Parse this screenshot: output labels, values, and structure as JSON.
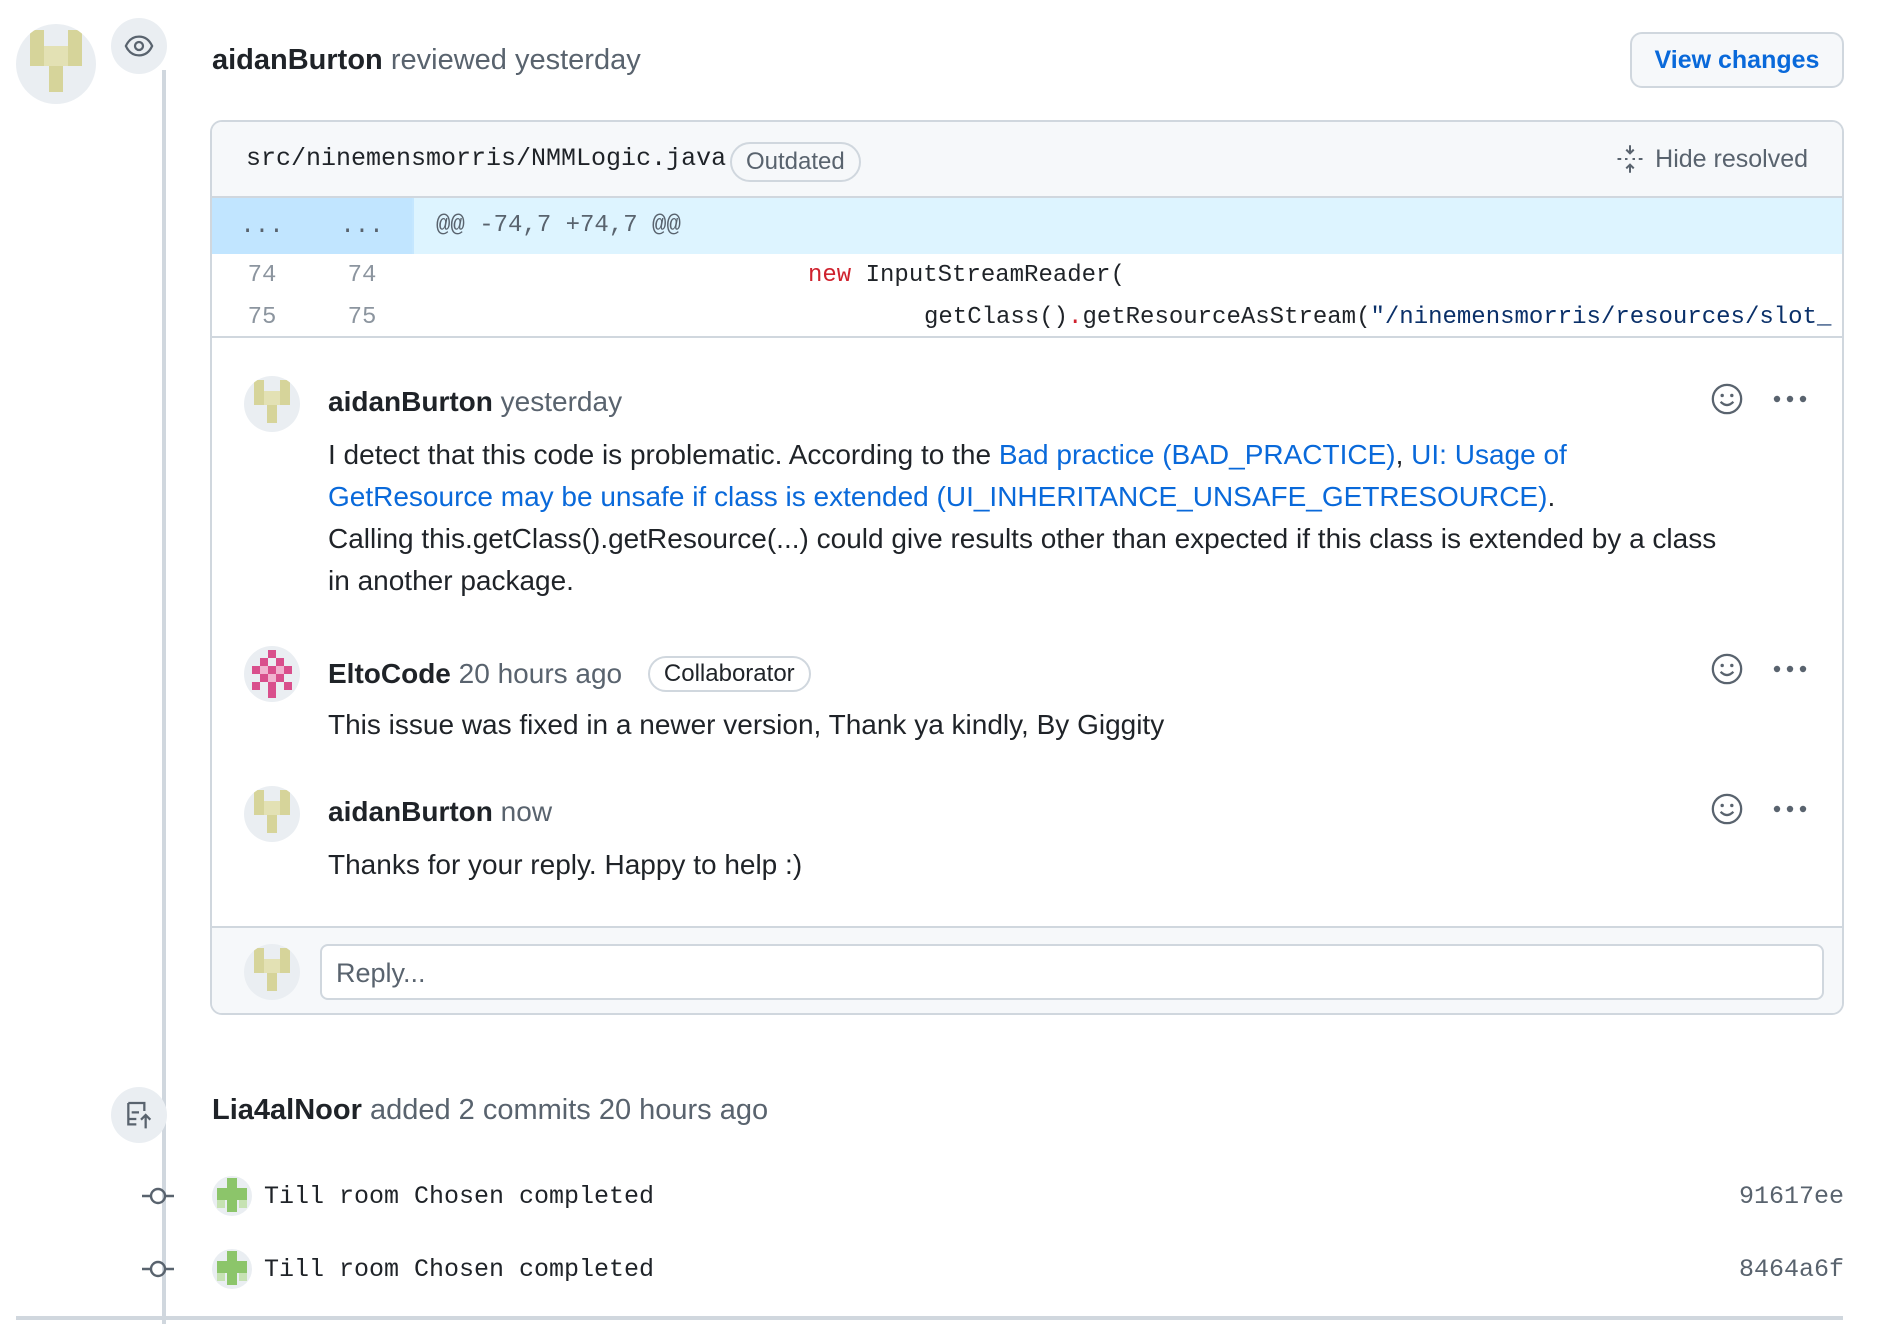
{
  "review": {
    "author": "aidanBurton",
    "action": "reviewed",
    "time": "yesterday",
    "view_changes_label": "View changes"
  },
  "file": {
    "path": "src/ninemensmorris/NMMLogic.java",
    "status_badge": "Outdated",
    "hide_resolved_label": "Hide resolved"
  },
  "diff": {
    "hunk_left": "...",
    "hunk_right": "...",
    "hunk_header": "@@ -74,7 +74,7 @@",
    "lines": [
      {
        "old": "74",
        "new": "74",
        "kw": "new",
        "text": " InputStreamReader("
      },
      {
        "old": "75",
        "new": "75",
        "pre": "getClass()",
        "dot": ".",
        "mid": "getResourceAsStream(",
        "str": "\"/ninemensmorris/resources/slot_"
      }
    ]
  },
  "comments": [
    {
      "author": "aidanBurton",
      "time": "yesterday",
      "body_intro": "I detect that this code is problematic. According to the ",
      "link1": "Bad practice (BAD_PRACTICE)",
      "sep": ", ",
      "link2": "UI: Usage of GetResource may be unsafe if class is extended (UI_INHERITANCE_UNSAFE_GETRESOURCE)",
      "period": ".",
      "body_rest": "Calling this.getClass().getResource(...) could give results other than expected if this class is extended by a class in another package."
    },
    {
      "author": "EltoCode",
      "time": "20 hours ago",
      "role": "Collaborator",
      "body": "This issue was fixed in a newer version, Thank ya kindly, By Giggity"
    },
    {
      "author": "aidanBurton",
      "time": "now",
      "body": "Thanks for your reply. Happy to help :)"
    }
  ],
  "reply": {
    "placeholder": "Reply..."
  },
  "commits_event": {
    "author": "Lia4alNoor",
    "text": "added 2 commits",
    "time": "20 hours ago",
    "commits": [
      {
        "message": "Till room Chosen completed",
        "sha": "91617ee"
      },
      {
        "message": "Till room Chosen completed",
        "sha": "8464a6f"
      }
    ]
  },
  "colors": {
    "link": "#0969da",
    "muted": "#59636e",
    "border": "#d0d7de",
    "hunk_bg": "#ddf4ff"
  }
}
